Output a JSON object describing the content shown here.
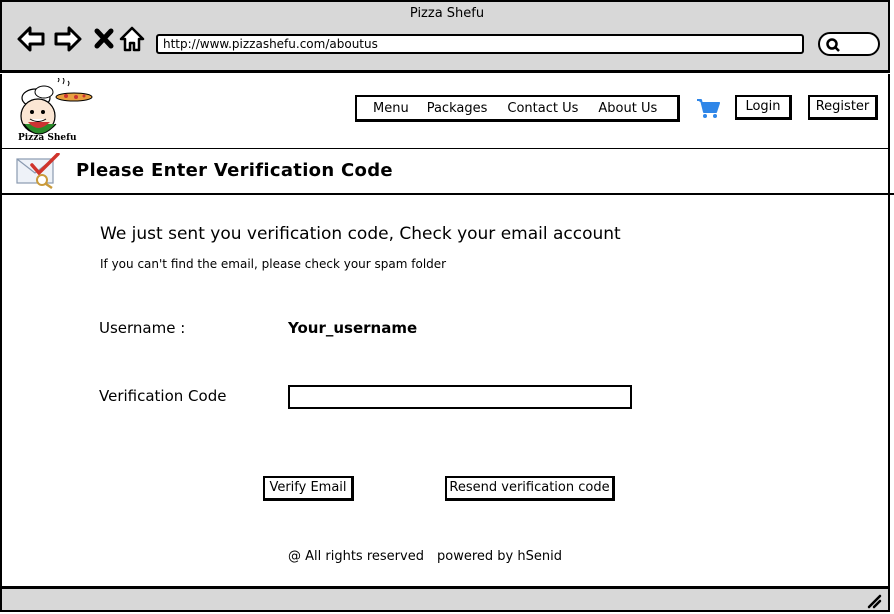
{
  "window": {
    "title": "Pizza Shefu"
  },
  "toolbar": {
    "url": "http://www.pizzashefu.com/aboutus"
  },
  "brand": {
    "logo_text": "Pizza Shefu"
  },
  "nav": {
    "items": [
      {
        "label": "Menu"
      },
      {
        "label": "Packages"
      },
      {
        "label": "Contact Us"
      },
      {
        "label": "About Us"
      }
    ],
    "login_label": "Login",
    "register_label": "Register"
  },
  "page": {
    "title": "Please Enter Verification Code",
    "headline": "We just sent you verification code, Check your email account",
    "subline": "If you can't find the email, please check your spam folder"
  },
  "form": {
    "username_label": "Username :",
    "username_value": "Your_username",
    "code_label": "Verification Code",
    "code_value": "",
    "verify_label": "Verify Email",
    "resend_label": "Resend verification code"
  },
  "footer": {
    "rights": "@ All rights reserved",
    "powered": "powered by hSenid"
  },
  "colors": {
    "chrome_gray": "#d8d8d8",
    "cart_blue": "#2f86e8"
  },
  "icons": [
    "back-arrow-icon",
    "forward-arrow-icon",
    "close-icon",
    "home-icon",
    "search-icon",
    "cart-icon",
    "mail-check-icon",
    "resize-grip-icon"
  ]
}
